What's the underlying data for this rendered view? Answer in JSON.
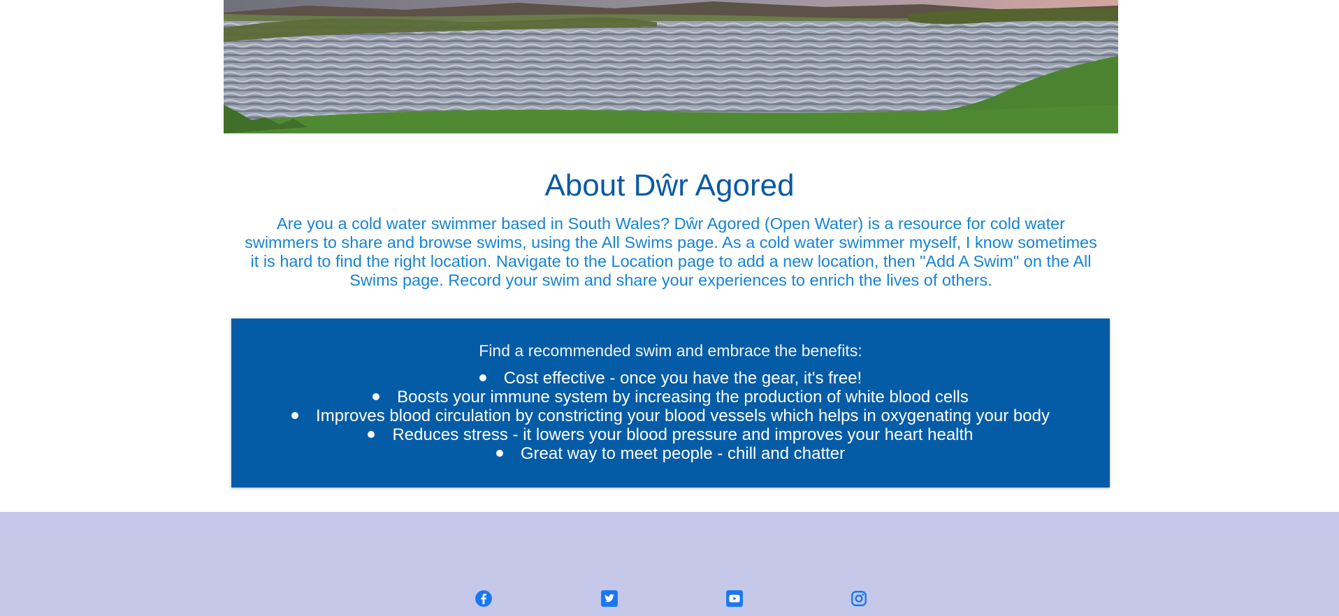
{
  "hero": {
    "icon": "lake-landscape-image",
    "colors": {
      "sky": "#c9a9a6",
      "hills": "#5d5247",
      "water": "#a3abba",
      "grass": "#4b8331"
    }
  },
  "about": {
    "title": "About Dŵr Agored",
    "description": "Are you a cold water swimmer based in South Wales? Dŵr Agored (Open Water) is a resource for cold water swimmers to share and browse swims, using the All Swims page. As a cold water swimmer myself, I know sometimes it is hard to find the right location. Navigate to the Location page to add a new location, then \"Add A Swim\" on the All Swims page. Record your swim and share your experiences to enrich the lives of others."
  },
  "benefits": {
    "heading": "Find a recommended swim and embrace the benefits:",
    "items": [
      "Cost effective - once you have the gear, it's free!",
      "Boosts your immune system by increasing the production of white blood cells",
      "Improves blood circulation by constricting your blood vessels which helps in oxygenating your body",
      "Reduces stress - it lowers your blood pressure and improves your heart health",
      "Great way to meet people - chill and chatter"
    ]
  },
  "footer": {
    "social": [
      {
        "name": "facebook-icon"
      },
      {
        "name": "twitter-icon"
      },
      {
        "name": "youtube-icon"
      },
      {
        "name": "instagram-icon"
      }
    ]
  },
  "colors": {
    "title": "#0a5aa3",
    "text": "#1684d4",
    "benefits_bg": "#055ca6",
    "footer_bg": "#c5c8e8",
    "social_icon": "#1877f2"
  }
}
